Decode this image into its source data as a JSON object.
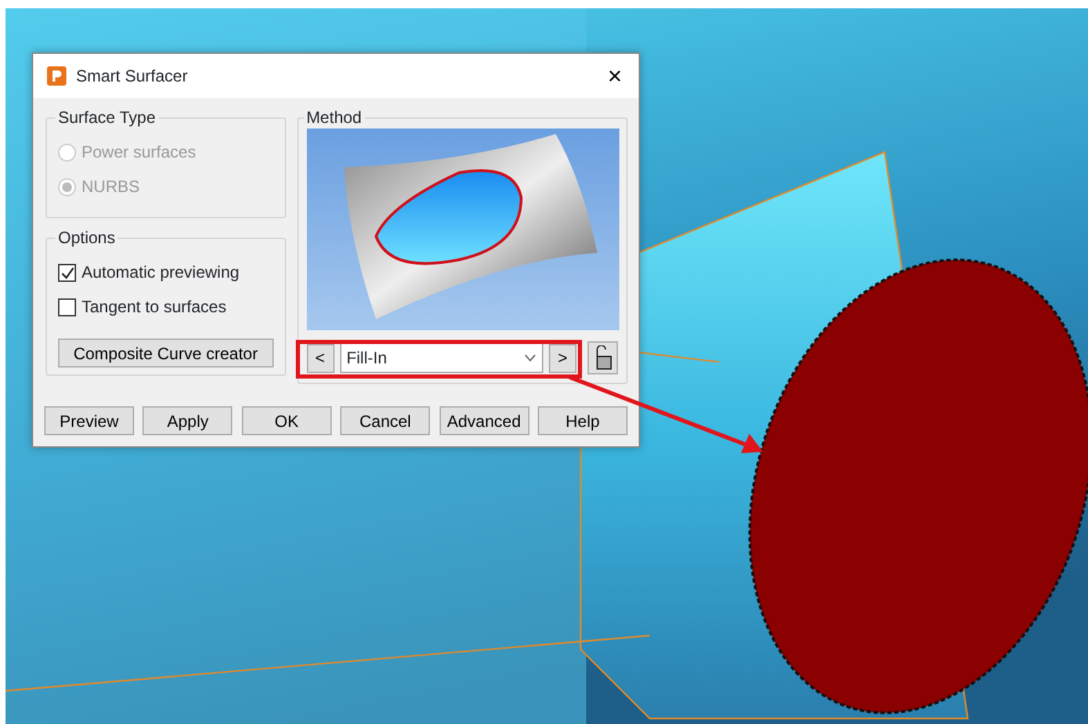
{
  "window": {
    "title": "Smart Surfacer",
    "close": "×"
  },
  "surface_type": {
    "title": "Surface Type",
    "options": [
      {
        "label": "Power surfaces",
        "selected": false,
        "disabled": true
      },
      {
        "label": "NURBS",
        "selected": true,
        "disabled": true
      }
    ]
  },
  "options": {
    "title": "Options",
    "checkboxes": [
      {
        "label": "Automatic previewing",
        "checked": true
      },
      {
        "label": "Tangent to surfaces",
        "checked": false
      }
    ],
    "button": "Composite Curve creator"
  },
  "method": {
    "title": "Method",
    "prev": "<",
    "value": "Fill-In",
    "next": ">"
  },
  "buttons": [
    "Preview",
    "Apply",
    "OK",
    "Cancel",
    "Advanced",
    "Help"
  ]
}
